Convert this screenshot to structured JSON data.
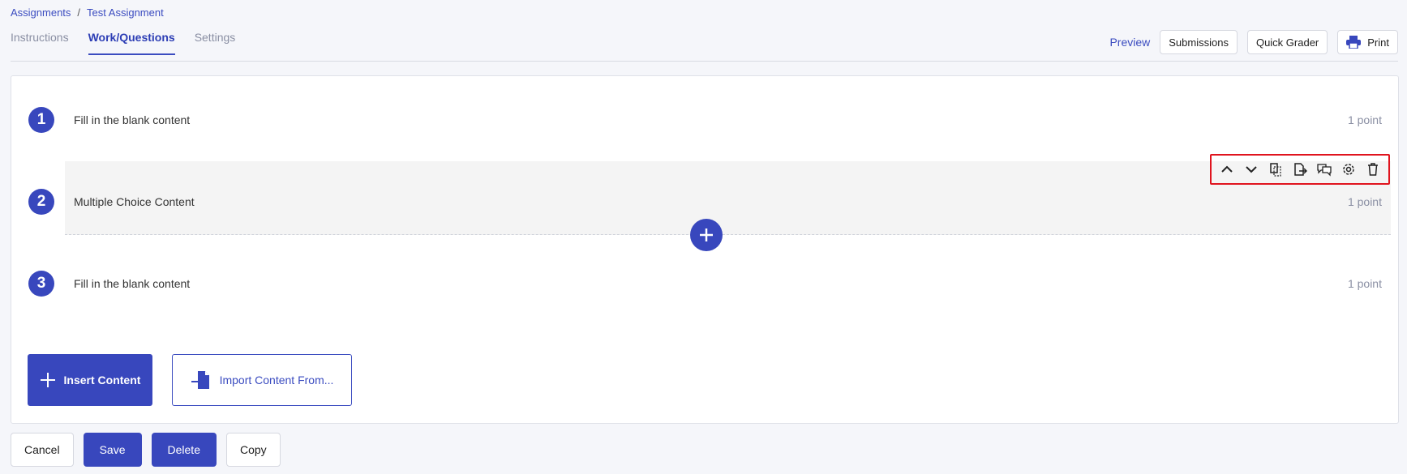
{
  "breadcrumb": {
    "parent": "Assignments",
    "separator": "/",
    "current": "Test Assignment"
  },
  "tabs": [
    {
      "label": "Instructions"
    },
    {
      "label": "Work/Questions"
    },
    {
      "label": "Settings"
    }
  ],
  "active_tab": "Work/Questions",
  "top_actions": {
    "preview": "Preview",
    "submissions": "Submissions",
    "quick_grader": "Quick Grader",
    "print": "Print"
  },
  "questions": [
    {
      "number": "1",
      "text": "Fill in the blank content",
      "points": "1 point"
    },
    {
      "number": "2",
      "text": "Multiple Choice Content",
      "points": "1 point"
    },
    {
      "number": "3",
      "text": "Fill in the blank content",
      "points": "1 point"
    }
  ],
  "toolbar_icons": [
    "chevron-up-icon",
    "chevron-down-icon",
    "duplicate-icon",
    "export-icon",
    "comment-icon",
    "gear-icon",
    "trash-icon"
  ],
  "content_actions": {
    "insert": "Insert Content",
    "import": "Import Content From..."
  },
  "bottom_actions": {
    "cancel": "Cancel",
    "save": "Save",
    "delete": "Delete",
    "copy": "Copy"
  },
  "colors": {
    "accent": "#3847bd",
    "highlight_border": "#e0141e",
    "muted": "#8a8fa3"
  }
}
